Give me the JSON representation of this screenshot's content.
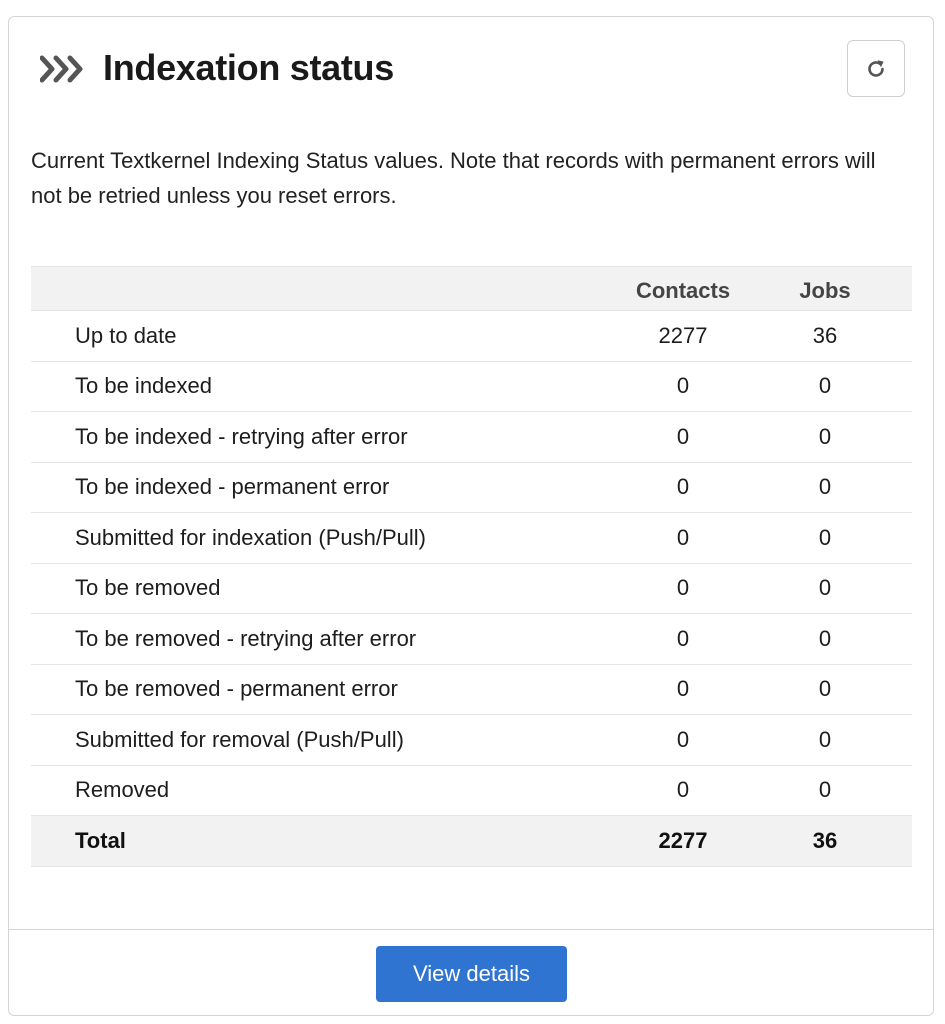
{
  "header": {
    "title": "Indexation status",
    "icon": "triple-chevron-icon",
    "refresh_icon": "refresh-icon"
  },
  "description": "Current Textkernel Indexing Status values. Note that records with permanent errors will not be retried unless you reset errors.",
  "table": {
    "columns": [
      "",
      "Contacts",
      "Jobs"
    ],
    "rows": [
      {
        "label": "Up to date",
        "contacts": "2277",
        "jobs": "36"
      },
      {
        "label": "To be indexed",
        "contacts": "0",
        "jobs": "0"
      },
      {
        "label": "To be indexed - retrying after error",
        "contacts": "0",
        "jobs": "0"
      },
      {
        "label": "To be indexed - permanent error",
        "contacts": "0",
        "jobs": "0"
      },
      {
        "label": "Submitted for indexation (Push/Pull)",
        "contacts": "0",
        "jobs": "0"
      },
      {
        "label": "To be removed",
        "contacts": "0",
        "jobs": "0"
      },
      {
        "label": "To be removed - retrying after error",
        "contacts": "0",
        "jobs": "0"
      },
      {
        "label": "To be removed - permanent error",
        "contacts": "0",
        "jobs": "0"
      },
      {
        "label": "Submitted for removal (Push/Pull)",
        "contacts": "0",
        "jobs": "0"
      },
      {
        "label": "Removed",
        "contacts": "0",
        "jobs": "0"
      }
    ],
    "total": {
      "label": "Total",
      "contacts": "2277",
      "jobs": "36"
    }
  },
  "footer": {
    "view_details_label": "View details"
  },
  "colors": {
    "primary": "#2f74d0",
    "header_row_bg": "#f2f2f2",
    "border": "#d5d5d5"
  }
}
